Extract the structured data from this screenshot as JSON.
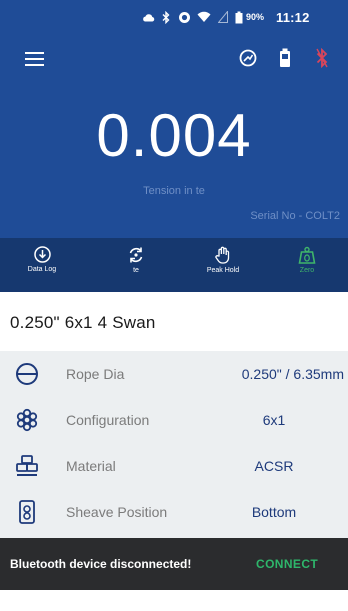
{
  "status_bar": {
    "battery_text": "90%",
    "time": "11:12",
    "icons": [
      "cloud-icon",
      "bluetooth-icon",
      "alarm-icon",
      "wifi-icon",
      "signal-icon",
      "battery-icon"
    ]
  },
  "header": {
    "menu_icon": "hamburger-menu-icon",
    "action_icons": [
      "tare-gauge-icon",
      "device-battery-icon",
      "bluetooth-disconnected-icon"
    ],
    "reading": "0.004",
    "unit_label": "Tension in te",
    "serial": "Serial No - COLT2"
  },
  "toolbar": {
    "items": [
      {
        "label": "Data Log",
        "icon": "download-icon"
      },
      {
        "label": "te",
        "icon": "refresh-unit-icon"
      },
      {
        "label": "Peak Hold",
        "icon": "hand-icon"
      },
      {
        "label": "Zero",
        "icon": "zero-weight-icon"
      }
    ]
  },
  "rope": {
    "title": "0.250\" 6x1 4 Swan",
    "rows": [
      {
        "label": "Rope Dia",
        "value": "0.250\" / 6.35mm",
        "icon": "rope-diameter-icon"
      },
      {
        "label": "Configuration",
        "value": "6x1",
        "icon": "configuration-icon"
      },
      {
        "label": "Material",
        "value": "ACSR",
        "icon": "material-icon"
      },
      {
        "label": "Sheave Position",
        "value": "Bottom",
        "icon": "sheave-position-icon"
      }
    ]
  },
  "snackbar": {
    "message": "Bluetooth device disconnected!",
    "action": "CONNECT"
  },
  "colors": {
    "header_bg": "#1f4c97",
    "toolbar_bg": "#16386f",
    "accent_green": "#2eb66b",
    "value_blue": "#1e3a7b",
    "bluetooth_off": "#d9465b"
  }
}
